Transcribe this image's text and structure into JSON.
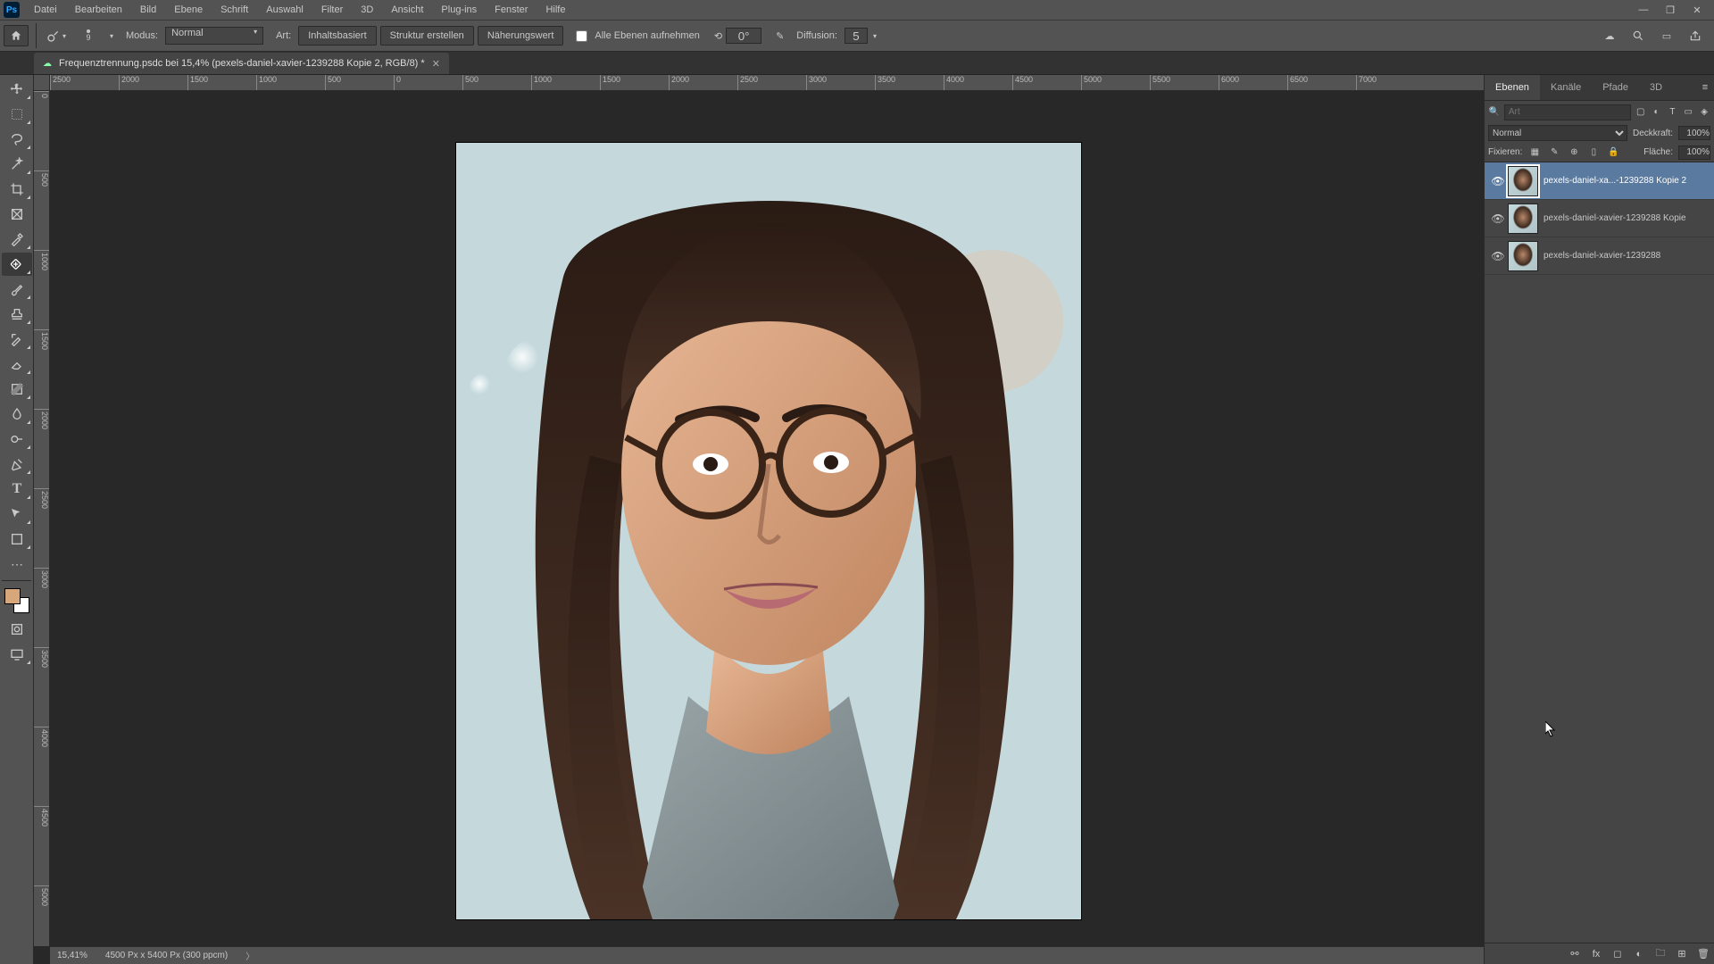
{
  "app_logo": "Ps",
  "menu": [
    "Datei",
    "Bearbeiten",
    "Bild",
    "Ebene",
    "Schrift",
    "Auswahl",
    "Filter",
    "3D",
    "Ansicht",
    "Plug-ins",
    "Fenster",
    "Hilfe"
  ],
  "options": {
    "brush_size": "9",
    "modus_label": "Modus:",
    "modus_value": "Normal",
    "art_label": "Art:",
    "btn_inhalt": "Inhaltsbasiert",
    "btn_struktur": "Struktur erstellen",
    "btn_naeherung": "Näherungswert",
    "sample_all_label": "Alle Ebenen aufnehmen",
    "angle": "0°",
    "diffusion_label": "Diffusion:",
    "diffusion_value": "5"
  },
  "doc_tab": {
    "title": "Frequenztrennung.psdc bei 15,4% (pexels-daniel-xavier-1239288 Kopie 2, RGB/8) *"
  },
  "ruler_h": [
    "0",
    "500",
    "1000",
    "1500",
    "2000",
    "2500",
    "3000",
    "3500",
    "4000",
    "4500",
    "5000",
    "5500",
    "6000",
    "6500",
    "7000"
  ],
  "ruler_h_neg": [
    "2500",
    "2000",
    "1500",
    "1000",
    "500"
  ],
  "ruler_v": [
    "0",
    "500",
    "1000",
    "1500",
    "2000",
    "2500",
    "3000",
    "3500",
    "4000",
    "4500",
    "5000"
  ],
  "status": {
    "zoom": "15,41%",
    "dims": "4500 Px x 5400 Px (300 ppcm)"
  },
  "panels": {
    "tabs": [
      "Ebenen",
      "Kanäle",
      "Pfade",
      "3D"
    ],
    "search_placeholder": "Art",
    "blend_label": "",
    "blend_mode": "Normal",
    "opacity_label": "Deckkraft:",
    "opacity_value": "100%",
    "lock_label": "Fixieren:",
    "fill_label": "Fläche:",
    "fill_value": "100%",
    "layers": [
      {
        "name": "pexels-daniel-xa...-1239288 Kopie 2",
        "visible": true,
        "selected": true
      },
      {
        "name": "pexels-daniel-xavier-1239288 Kopie",
        "visible": true,
        "selected": false
      },
      {
        "name": "pexels-daniel-xavier-1239288",
        "visible": true,
        "selected": false
      }
    ]
  },
  "colors": {
    "fg": "#d6a77a",
    "bg": "#ffffff"
  },
  "tool_icons": [
    "move",
    "marquee",
    "lasso",
    "wand",
    "crop",
    "frame",
    "eyedrop",
    "heal",
    "brush",
    "stamp",
    "history",
    "eraser",
    "gradient",
    "blur",
    "dodge",
    "pen",
    "type",
    "path",
    "shape",
    "hand",
    "zoom"
  ]
}
